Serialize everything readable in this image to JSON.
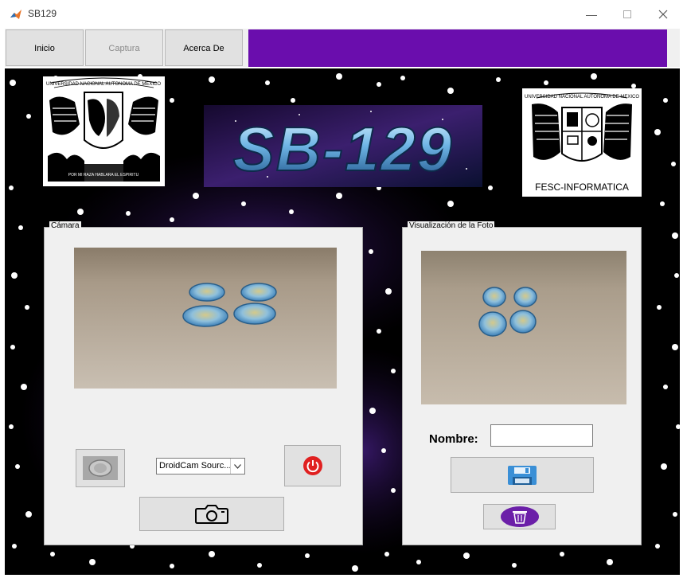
{
  "window": {
    "title": "SB129",
    "icon": "matlab-icon",
    "controls": [
      "minimize-icon",
      "maximize-icon",
      "close-icon"
    ]
  },
  "tabs": [
    {
      "label": "Inicio",
      "enabled": true
    },
    {
      "label": "Captura",
      "enabled": false
    },
    {
      "label": "Acerca De",
      "enabled": true
    }
  ],
  "colors": {
    "tab_accent": "#6a0dad",
    "background": "#000000",
    "delete_button": "#6b1fa8",
    "power_button": "#e02020",
    "save_button": "#3a8fd6"
  },
  "header": {
    "banner_text": "SB-129",
    "left_logo_ring": "UNIVERSIDAD NACIONAL AUTONOMA DE MEXICO",
    "left_logo_motto": "POR MI RAZA HABLARA EL ESPIRITU",
    "right_logo_ring": "UNIVERSIDAD NACIONAL AUTONOMA DE MEXICO",
    "right_logo_caption": "FESC-INFORMATICA"
  },
  "camera_panel": {
    "title": "Cámara",
    "camera_source": "DroidCam Sourc...",
    "buttons": [
      "preview-button",
      "power-button",
      "capture-button"
    ]
  },
  "photo_panel": {
    "title": "Visualización de la Foto",
    "name_label": "Nombre:",
    "name_value": "",
    "buttons": [
      "save-button",
      "delete-button"
    ]
  }
}
